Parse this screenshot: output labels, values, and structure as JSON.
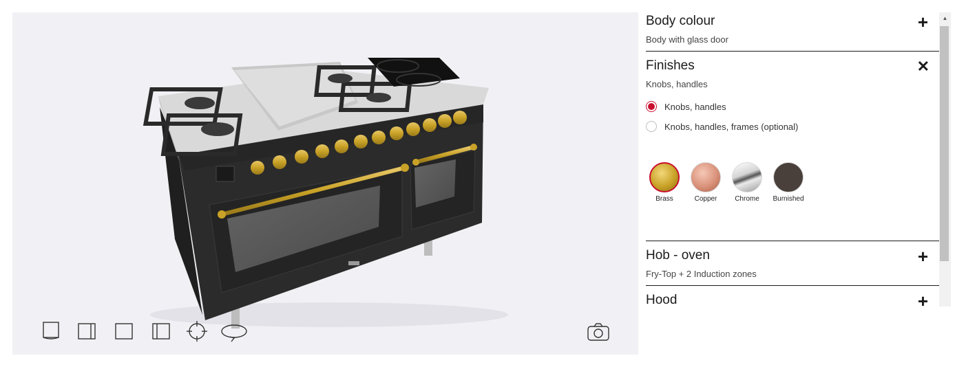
{
  "viewer": {
    "tools": [
      {
        "name": "front-view-icon"
      },
      {
        "name": "side-view-icon"
      },
      {
        "name": "top-view-icon"
      },
      {
        "name": "angle-view-icon"
      },
      {
        "name": "center-target-icon"
      },
      {
        "name": "rotate-icon"
      }
    ],
    "camera_icon": "camera-icon"
  },
  "sections": {
    "body_colour": {
      "title": "Body colour",
      "subtitle": "Body with glass door",
      "toggle": "+"
    },
    "finishes": {
      "title": "Finishes",
      "subtitle": "Knobs, handles",
      "toggle": "✕",
      "options": [
        {
          "label": "Knobs, handles",
          "selected": true
        },
        {
          "label": "Knobs, handles, frames (optional)",
          "selected": false
        }
      ],
      "swatches": [
        {
          "label": "Brass",
          "color": "#c9a227",
          "selected": true
        },
        {
          "label": "Copper",
          "color": "#d9917a",
          "selected": false
        },
        {
          "label": "Chrome",
          "color": "#d4d4d4",
          "selected": false
        },
        {
          "label": "Burnished",
          "color": "#4a403b",
          "selected": false
        }
      ]
    },
    "hob_oven": {
      "title": "Hob - oven",
      "subtitle": "Fry-Top + 2 Induction zones",
      "toggle": "+"
    },
    "hood": {
      "title": "Hood",
      "toggle": "+"
    }
  },
  "colors": {
    "accent": "#c8102e",
    "stove_body": "#2b2b2b",
    "brass": "#c9a227"
  }
}
